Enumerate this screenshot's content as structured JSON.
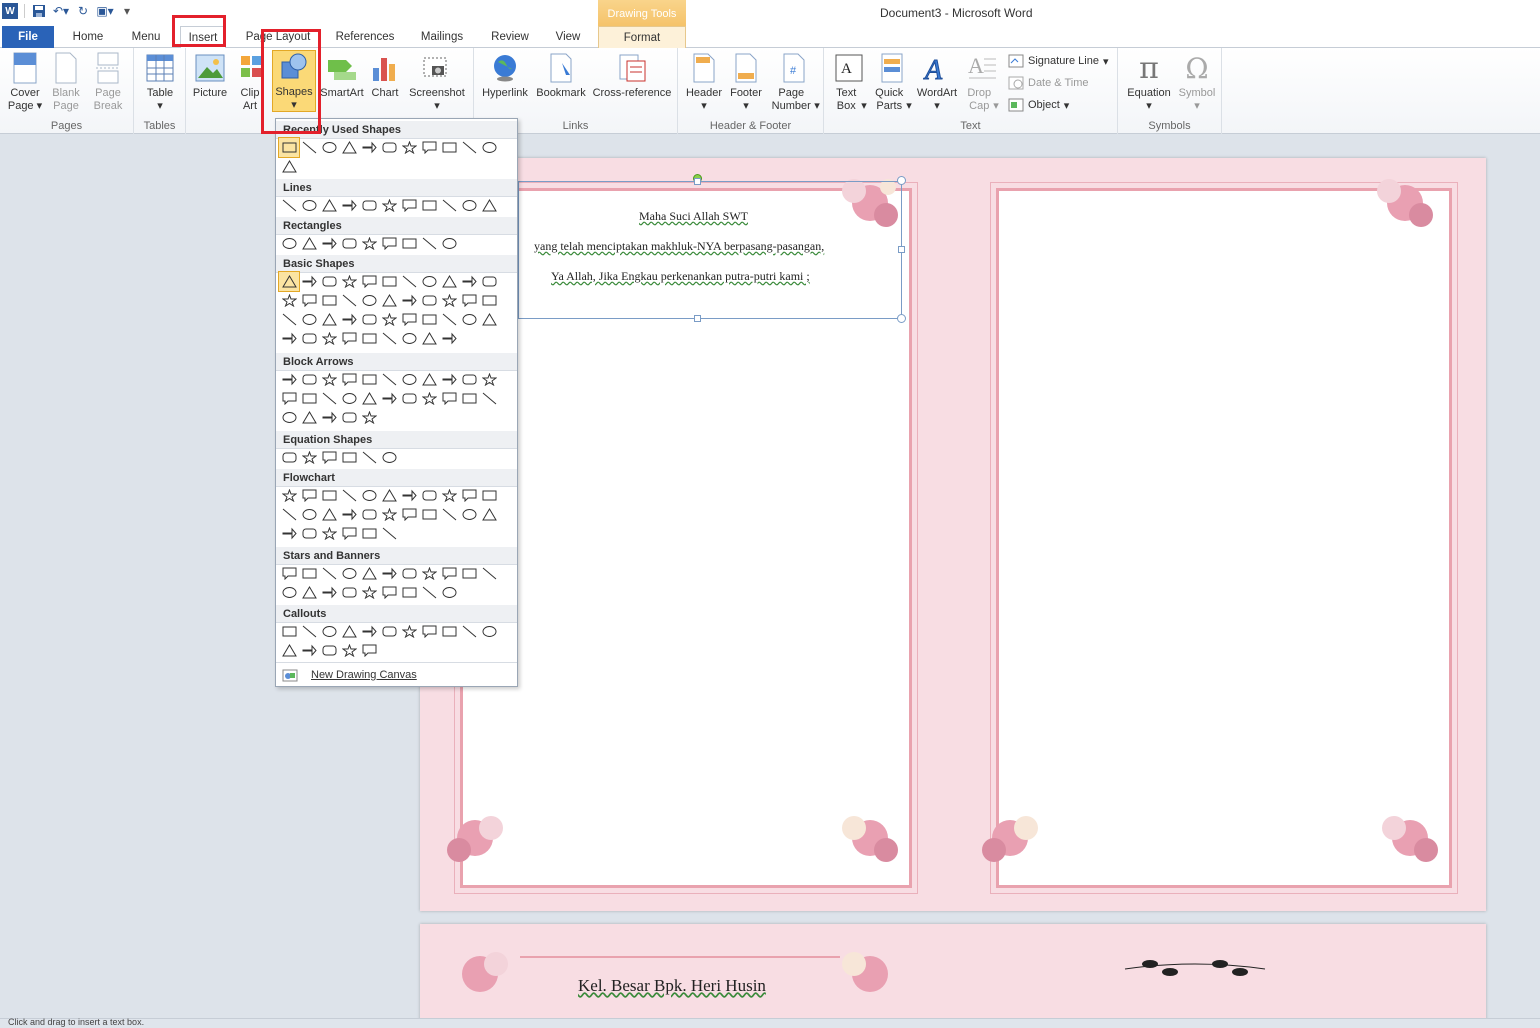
{
  "window": {
    "title": "Document3 - Microsoft Word",
    "context_tab_group": "Drawing Tools"
  },
  "tabs": [
    "File",
    "Home",
    "Menu",
    "Insert",
    "Page Layout",
    "References",
    "Mailings",
    "Review",
    "View",
    "Format"
  ],
  "ribbon": {
    "pages": {
      "label": "Pages",
      "cover_page": "Cover Page",
      "blank_page": "Blank Page",
      "page_break": "Page Break"
    },
    "tables": {
      "label": "Tables",
      "table": "Table"
    },
    "illustrations": {
      "picture": "Picture",
      "clip_art": "Clip Art",
      "shapes": "Shapes",
      "smartart": "SmartArt",
      "chart": "Chart",
      "screenshot": "Screenshot"
    },
    "links": {
      "label": "Links",
      "hyperlink": "Hyperlink",
      "bookmark": "Bookmark",
      "cross_reference": "Cross-reference"
    },
    "header_footer": {
      "label": "Header & Footer",
      "header": "Header",
      "footer": "Footer",
      "page_number": "Page Number"
    },
    "text": {
      "label": "Text",
      "text_box": "Text Box",
      "quick_parts": "Quick Parts",
      "wordart": "WordArt",
      "drop_cap": "Drop Cap",
      "signature_line": "Signature Line",
      "date_time": "Date & Time",
      "object": "Object"
    },
    "symbols": {
      "label": "Symbols",
      "equation": "Equation",
      "symbol": "Symbol"
    }
  },
  "shapes_menu": {
    "categories": [
      "Recently Used Shapes",
      "Lines",
      "Rectangles",
      "Basic Shapes",
      "Block Arrows",
      "Equation Shapes",
      "Flowchart",
      "Stars and Banners",
      "Callouts"
    ],
    "new_canvas": "New Drawing Canvas"
  },
  "document": {
    "lines": [
      "Maha Suci Allah SWT",
      "yang telah menciptakan makhluk-NYA berpasang-pasangan,",
      "Ya Allah, Jika Engkau perkenankan putra-putri kami ;"
    ],
    "page2_text": "Kel. Besar Bpk. Heri Husin"
  },
  "status_text": "Click and drag to insert a text box."
}
